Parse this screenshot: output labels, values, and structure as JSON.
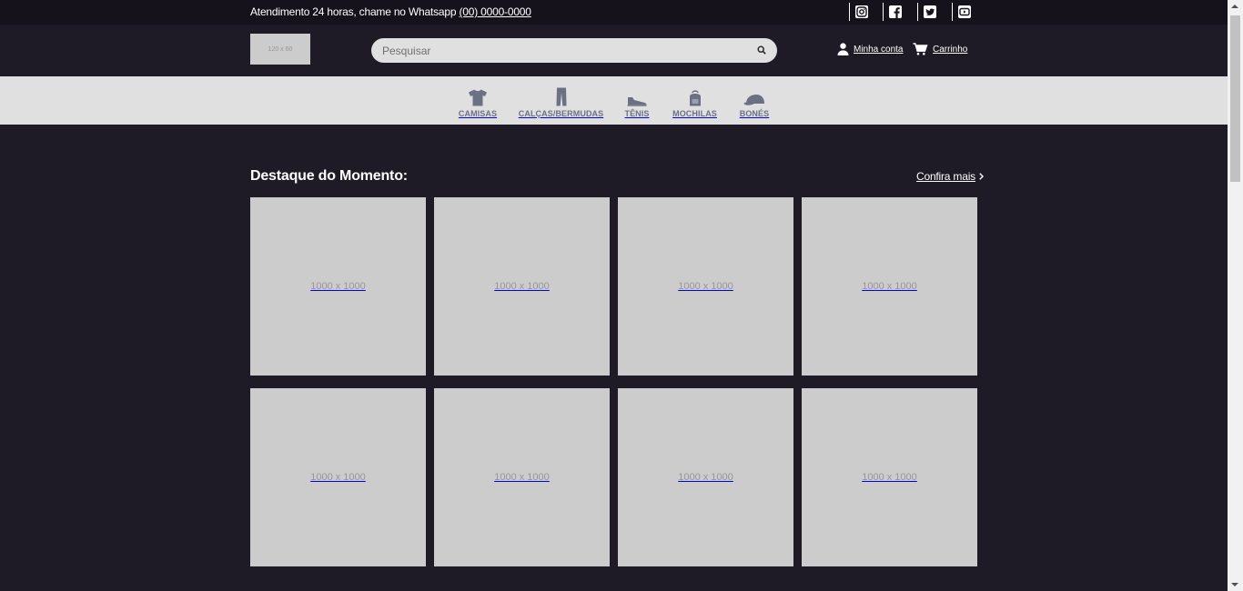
{
  "topbar": {
    "message": "Atendimento 24 horas, chame no Whatsapp",
    "phone": "(00) 0000-0000",
    "social": [
      {
        "icon": "instagram-icon"
      },
      {
        "icon": "facebook-icon"
      },
      {
        "icon": "twitter-icon"
      },
      {
        "icon": "youtube-icon"
      }
    ]
  },
  "header": {
    "logo_text": "120 x 60",
    "search_placeholder": "Pesquisar",
    "account_label": "Minha conta",
    "cart_label": "Carrinho"
  },
  "categories": [
    {
      "label": "CAMISAS",
      "icon": "shirt-icon"
    },
    {
      "label": "CALÇAS/BERMUDAS",
      "icon": "pants-icon"
    },
    {
      "label": "TÊNIS",
      "icon": "sneaker-icon"
    },
    {
      "label": "MOCHILAS",
      "icon": "backpack-icon"
    },
    {
      "label": "BONÉS",
      "icon": "cap-icon"
    }
  ],
  "featured": {
    "title": "Destaque do Momento:",
    "more_label": "Confira mais",
    "products": [
      {
        "image_text": "1000 x 1000"
      },
      {
        "image_text": "1000 x 1000"
      },
      {
        "image_text": "1000 x 1000"
      },
      {
        "image_text": "1000 x 1000"
      },
      {
        "image_text": "1000 x 1000"
      },
      {
        "image_text": "1000 x 1000"
      },
      {
        "image_text": "1000 x 1000"
      },
      {
        "image_text": "1000 x 1000"
      }
    ]
  },
  "colors": {
    "background": "#1e1b26",
    "topbar": "#15121c",
    "category_bar": "#e0e0e0",
    "category_text": "#6b7083",
    "placeholder": "#cccccc"
  }
}
